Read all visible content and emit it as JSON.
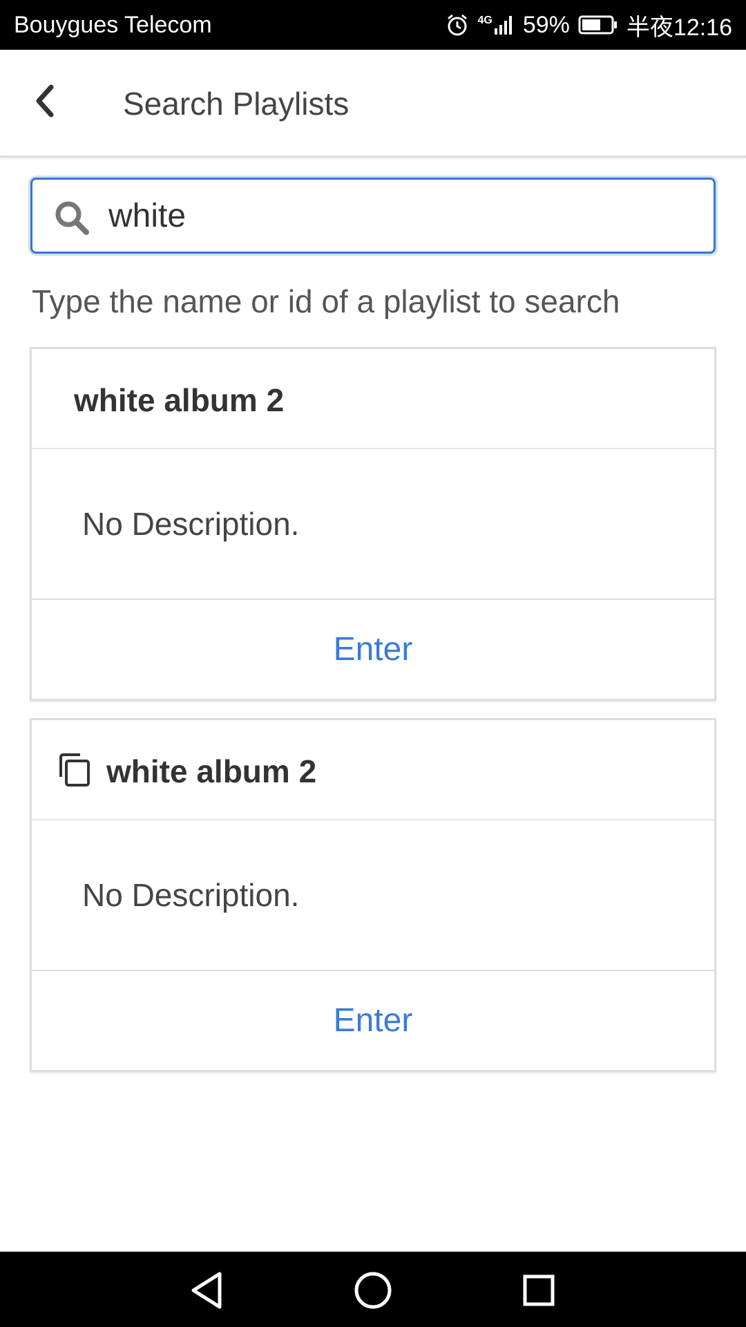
{
  "status_bar": {
    "carrier": "Bouygues Telecom",
    "network": "4G",
    "battery": "59%",
    "time": "半夜12:16",
    "icons": [
      "alarm-icon",
      "signal-icon",
      "battery-icon"
    ]
  },
  "header": {
    "back_icon": "chevron-left-icon",
    "title": "Search Playlists"
  },
  "search": {
    "icon": "search-icon",
    "value": "white"
  },
  "hint": "Type the name or id of a playlist to search",
  "results": [
    {
      "title": "white album 2",
      "description": "No Description.",
      "action_label": "Enter"
    },
    {
      "icon": "copy-icon",
      "title": "white album 2",
      "description": "No Description.",
      "action_label": "Enter"
    }
  ],
  "nav_bar": {
    "icons": [
      "back-triangle-icon",
      "home-circle-icon",
      "recent-square-icon"
    ]
  },
  "colors": {
    "accent": "#3a7bd5",
    "focus_border": "#3b73d4",
    "text_dark": "#333333",
    "border": "#dddddd"
  }
}
